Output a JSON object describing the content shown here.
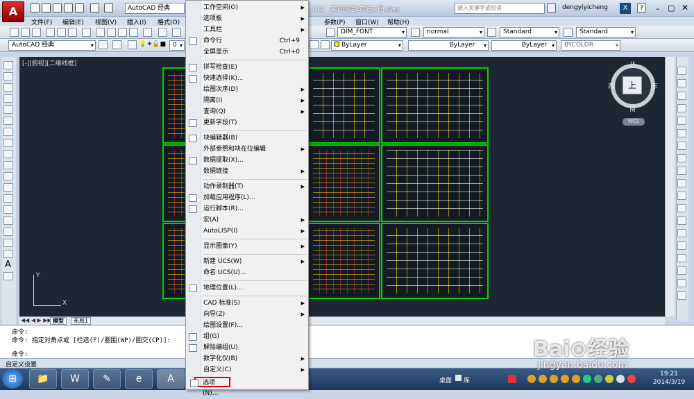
{
  "app": {
    "logo_glyph": "A",
    "workspace": "AutoCAD 经典",
    "version_fragment": "012",
    "document_title": "某超市建1筑施工图.dwg",
    "search_placeholder": "键入关键字或短语",
    "user": "dengyiyicheng",
    "accent_color": "#00d000"
  },
  "menubar": {
    "items": [
      "文件(F)",
      "编辑(E)",
      "视图(V)",
      "插入(I)",
      "格式(O)",
      "参数(P)",
      "窗口(W)",
      "帮助(H)"
    ]
  },
  "toolbars": {
    "textstyle": "DIM_FONT",
    "dimstyle": "normal",
    "tablestyle": "Standard",
    "mlstyle": "Standard",
    "workspace": "AutoCAD 经典",
    "layer": "0",
    "color": "ByLayer",
    "linetype": "ByLayer",
    "lineweight": "ByLayer",
    "plotstyle": "BYCOLOR"
  },
  "viewport": {
    "label": "[-][俯视][二维线框]",
    "compass": {
      "north": "北",
      "south": "南",
      "east": "东",
      "west": "西",
      "top": "上"
    },
    "wcs": "WCS"
  },
  "layout_tabs": [
    "模型",
    "布局1"
  ],
  "command": {
    "lines": [
      "命令:",
      "命令: 指定对角点或 [栏选(F)/圈围(WP)/圈交(CP)]:",
      "命令:"
    ]
  },
  "statusbar": {
    "text": "自定义设置"
  },
  "context_menu": [
    {
      "label": "工作空间(O)",
      "submenu": true
    },
    {
      "label": "选项板",
      "submenu": true
    },
    {
      "label": "工具栏",
      "submenu": true
    },
    {
      "label": "命令行",
      "shortcut": "Ctrl+9"
    },
    {
      "label": "全屏显示",
      "shortcut": "Ctrl+0"
    },
    {
      "label": "拼写检查(E)"
    },
    {
      "label": "快速选择(K)..."
    },
    {
      "label": "绘图次序(D)",
      "submenu": true
    },
    {
      "label": "隔离(I)",
      "submenu": true
    },
    {
      "label": "查询(Q)",
      "submenu": true
    },
    {
      "label": "更新字段(T)"
    },
    {
      "label": "块编辑器(B)"
    },
    {
      "label": "外部参照和块在位编辑",
      "submenu": true
    },
    {
      "label": "数据提取(X)..."
    },
    {
      "label": "数据链接",
      "submenu": true
    },
    {
      "label": "动作录制器(T)",
      "submenu": true
    },
    {
      "label": "加载应用程序(L)..."
    },
    {
      "label": "运行脚本(R)..."
    },
    {
      "label": "宏(A)",
      "submenu": true
    },
    {
      "label": "AutoLISP(I)",
      "submenu": true
    },
    {
      "label": "显示图像(Y)",
      "submenu": true
    },
    {
      "label": "新建 UCS(W)",
      "submenu": true
    },
    {
      "label": "命名 UCS(U)..."
    },
    {
      "label": "地理位置(L)..."
    },
    {
      "label": "CAD 标准(S)",
      "submenu": true
    },
    {
      "label": "向导(Z)",
      "submenu": true
    },
    {
      "label": "绘图设置(F)..."
    },
    {
      "label": "组(G)"
    },
    {
      "label": "解除编组(U)"
    },
    {
      "label": "数字化仪(B)",
      "submenu": true
    },
    {
      "label": "自定义(C)",
      "submenu": true
    },
    {
      "label": "选项(N)..."
    }
  ],
  "taskbar": {
    "desktop": "桌面",
    "library": "库",
    "time": "19:21",
    "date": "2014/3/19"
  },
  "watermark": {
    "brand": "Bai⊙经验",
    "url": "jingyan.baidu.com"
  }
}
